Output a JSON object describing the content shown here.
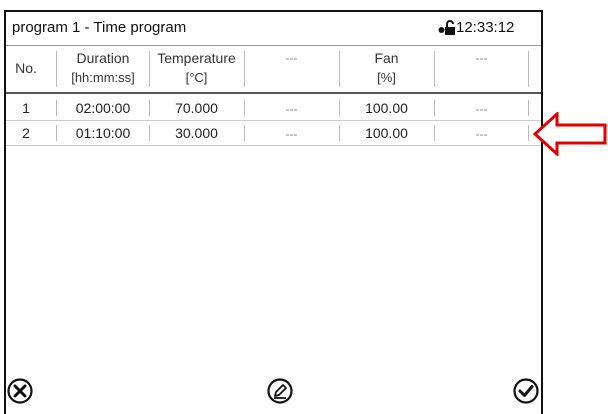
{
  "title": "program 1 - Time program",
  "time": "12:33:12",
  "columns": [
    {
      "line1": "No.",
      "line2": ""
    },
    {
      "line1": "Duration",
      "line2": "[hh:mm:ss]"
    },
    {
      "line1": "Temperature",
      "line2": "[°C]"
    },
    {
      "line1": "---",
      "line2": ""
    },
    {
      "line1": "Fan",
      "line2": "[%]"
    },
    {
      "line1": "---",
      "line2": ""
    }
  ],
  "rows": [
    {
      "no": "1",
      "duration": "02:00:00",
      "temperature": "70.000",
      "col3": "---",
      "fan": "100.00",
      "col5": "---"
    },
    {
      "no": "2",
      "duration": "01:10:00",
      "temperature": "30.000",
      "col3": "---",
      "fan": "100.00",
      "col5": "---"
    }
  ],
  "icons": {
    "lock": "lock-icon",
    "cancel": "close-circle-icon",
    "edit": "edit-pencil-icon",
    "confirm": "check-circle-icon",
    "pointer": "arrow-left-icon"
  },
  "colors": {
    "pointer_arrow": "#e00000"
  }
}
